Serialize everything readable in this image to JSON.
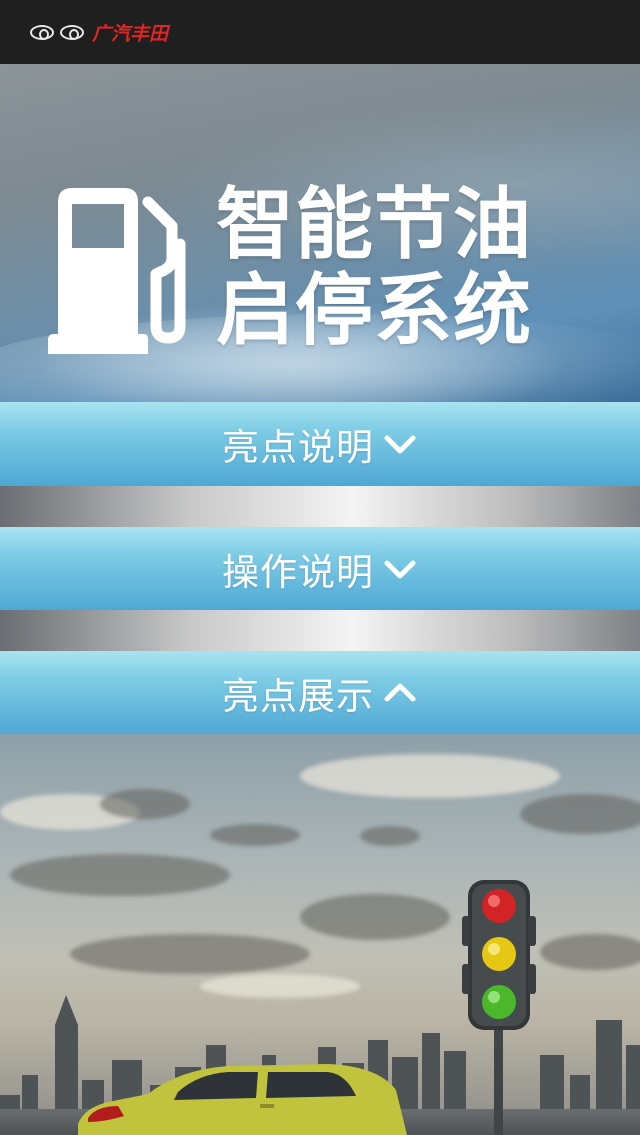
{
  "header": {
    "brand_text": "广汽丰田",
    "brand_color": "#e12424"
  },
  "hero": {
    "title_line1": "智能节油",
    "title_line2": "启停系统",
    "icon": "fuel-pump-icon"
  },
  "sections": [
    {
      "label": "亮点说明",
      "icon": "chevron-down-icon",
      "expanded": false
    },
    {
      "label": "操作说明",
      "icon": "chevron-down-icon",
      "expanded": false
    },
    {
      "label": "亮点展示",
      "icon": "chevron-up-icon",
      "expanded": true
    }
  ],
  "showcase": {
    "image": "city-traffic-light-car"
  },
  "colors": {
    "accordion_top": "#a9e3f0",
    "accordion_bottom": "#4ea7d4",
    "topbar": "#1f1f1f"
  }
}
